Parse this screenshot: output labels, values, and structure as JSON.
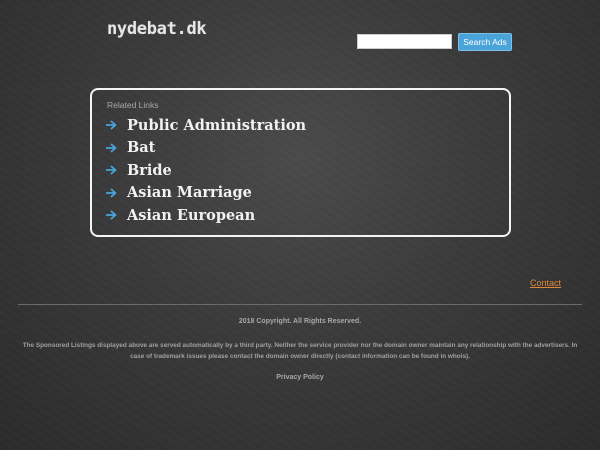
{
  "header": {
    "site_title": "nydebat.dk",
    "search_placeholder": "",
    "search_value": "",
    "search_button_label": "Search Ads"
  },
  "related_links": {
    "heading": "Related Links",
    "items": [
      {
        "label": "Public Administration"
      },
      {
        "label": "Bat"
      },
      {
        "label": "Bride"
      },
      {
        "label": "Asian Marriage"
      },
      {
        "label": "Asian European"
      }
    ]
  },
  "footer": {
    "contact_label": "Contact",
    "copyright": "2018 Copyright. All Rights Reserved.",
    "disclaimer": "The Sponsored Listings displayed above are served automatically by a third party. Neither the service provider nor the domain owner maintain any relationship with the advertisers. In case of trademark issues please contact the domain owner directly (contact information can be found in whois).",
    "privacy_label": "Privacy Policy"
  },
  "colors": {
    "background": "#3a3a3a",
    "accent_arrow": "#4aa3d9",
    "search_button": "#4aa3d9",
    "contact_link": "#e0883a",
    "box_border": "#f4f4f4"
  },
  "icons": {
    "link_bullet": "arrow-right-icon"
  }
}
